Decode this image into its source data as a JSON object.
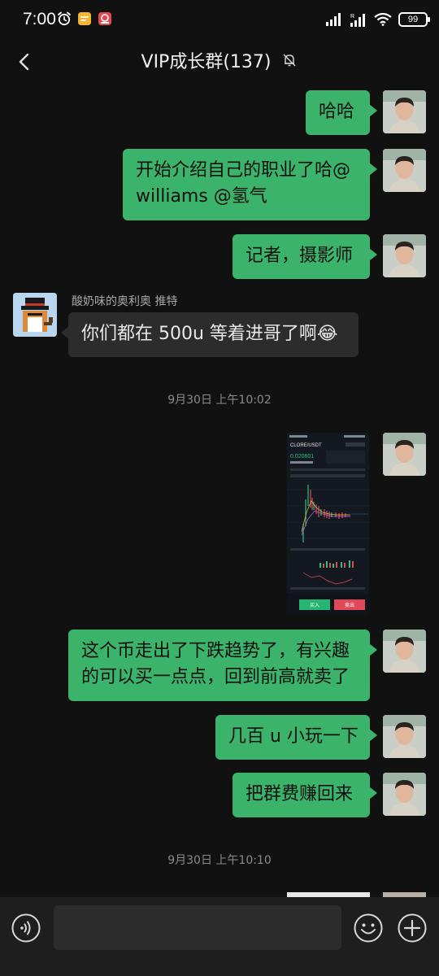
{
  "status_bar": {
    "time": "7:00",
    "battery_label": "99",
    "icons": [
      "alarm-icon",
      "notes-app-icon",
      "app-notification-icon",
      "signal-icon",
      "signal-r-icon",
      "wifi-icon",
      "battery-icon"
    ]
  },
  "header": {
    "title": "VIP成长群(137)",
    "back_icon": "chevron-left-icon",
    "mute_icon": "bell-off-icon"
  },
  "messages": [
    {
      "side": "me",
      "text": "哈哈"
    },
    {
      "side": "me",
      "lines": [
        "开始介绍自己的职业了哈@",
        "williams @氢气"
      ]
    },
    {
      "side": "me",
      "text": "记者，摄影师"
    },
    {
      "side": "other",
      "sender": "酸奶味的奥利奥 推特",
      "text": "你们都在 500u 等着进哥了啊😂"
    },
    {
      "side": "system",
      "timestamp": "9月30日 上午10:02"
    },
    {
      "side": "me",
      "type": "image",
      "image": {
        "pair": "CLORE/USDT",
        "price": "0.020601",
        "buy_label": "买入",
        "sell_label": "卖出"
      }
    },
    {
      "side": "me",
      "lines": [
        "这个币走出了下跌趋势了，有兴趣",
        "的可以买一点点，回到前高就卖了"
      ]
    },
    {
      "side": "me",
      "text": "几百 u 小玩一下"
    },
    {
      "side": "me",
      "text": "把群费赚回来"
    },
    {
      "side": "system",
      "timestamp": "9月30日 上午10:10"
    }
  ],
  "input_bar": {
    "voice_icon": "voice-icon",
    "emoji_icon": "emoji-icon",
    "plus_icon": "plus-circle-icon",
    "input_value": ""
  },
  "colors": {
    "background": "#111111",
    "my_bubble": "#3bb36a",
    "other_bubble": "#2c2c2c",
    "input_bar": "#1e1e1e"
  }
}
